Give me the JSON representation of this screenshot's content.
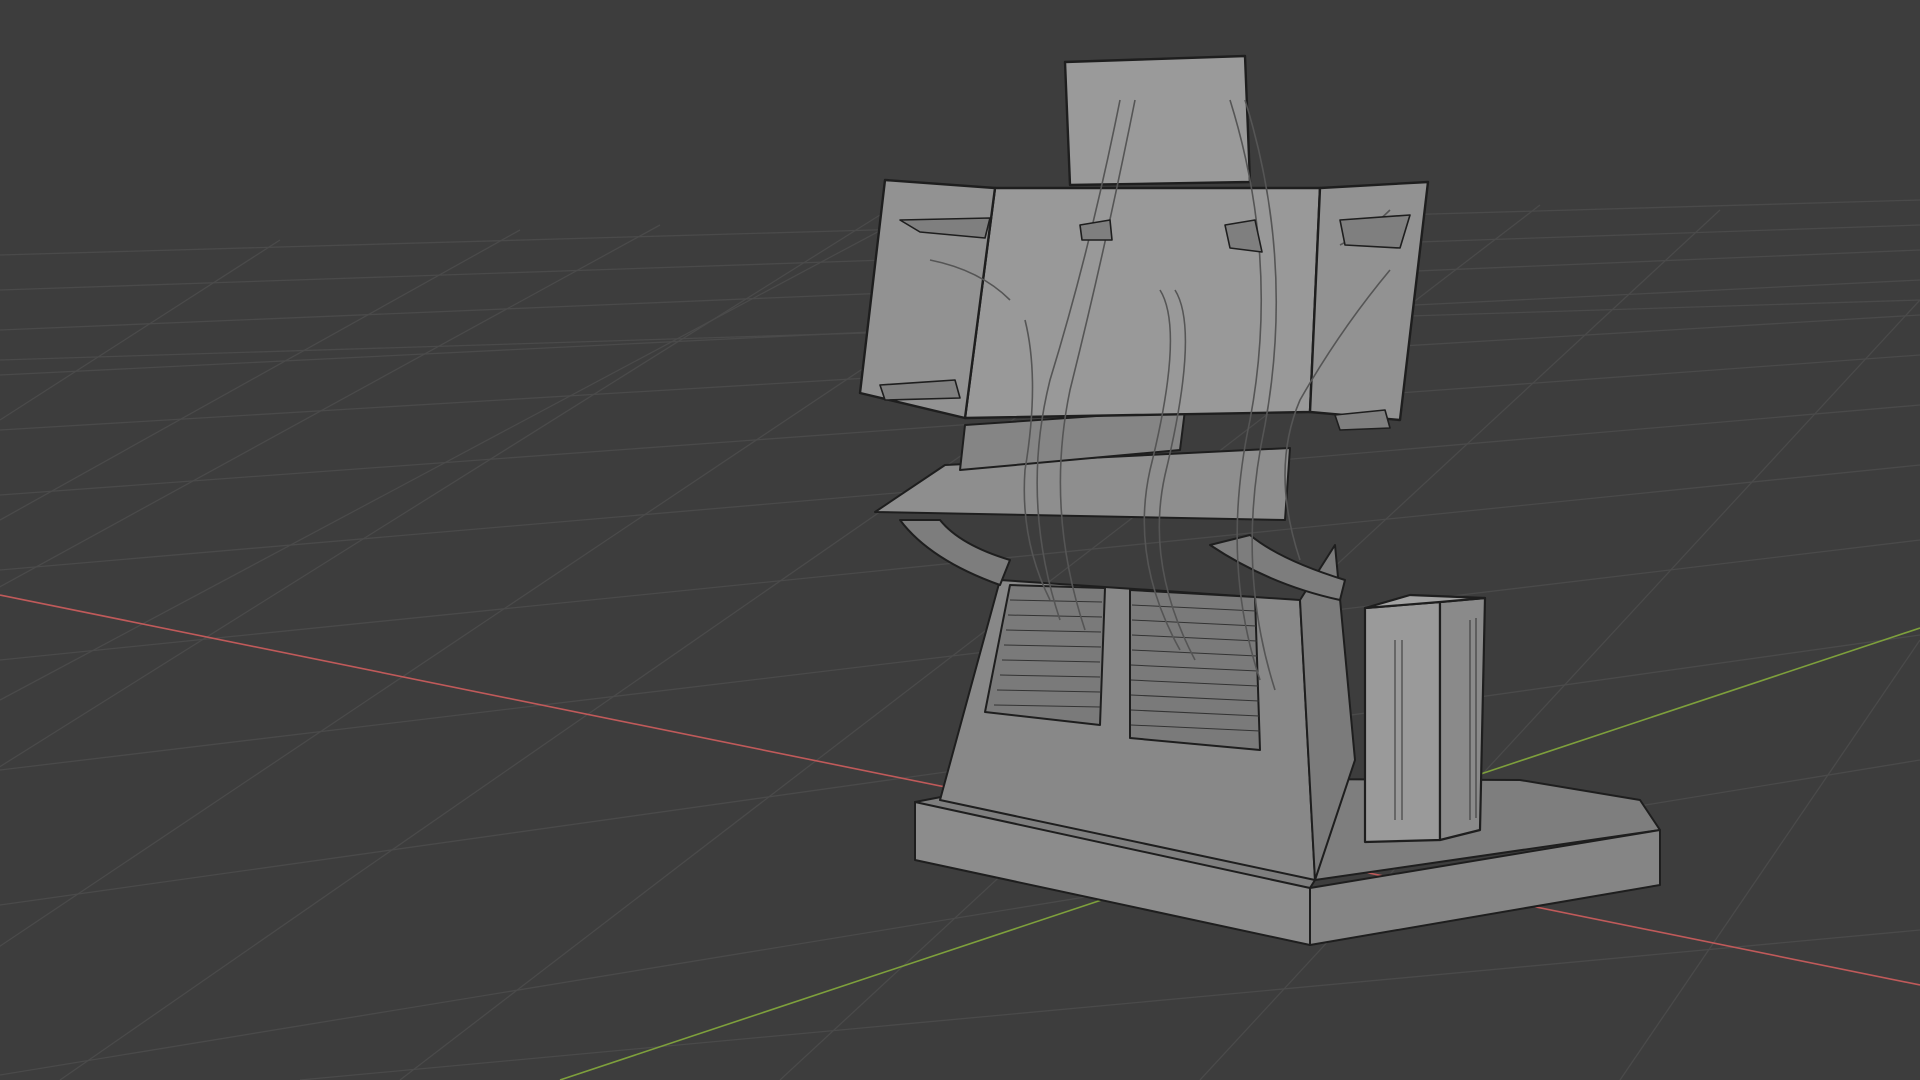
{
  "viewport": {
    "background": "#3d3d3d",
    "grid_color": "#4a4a4a",
    "x_axis_color": "#c05a5a",
    "y_axis_color": "#7ea03c",
    "object_fill": "#8a8a8a",
    "object_edge": "#1e1e1e",
    "object_wire": "#9c9c9c"
  }
}
